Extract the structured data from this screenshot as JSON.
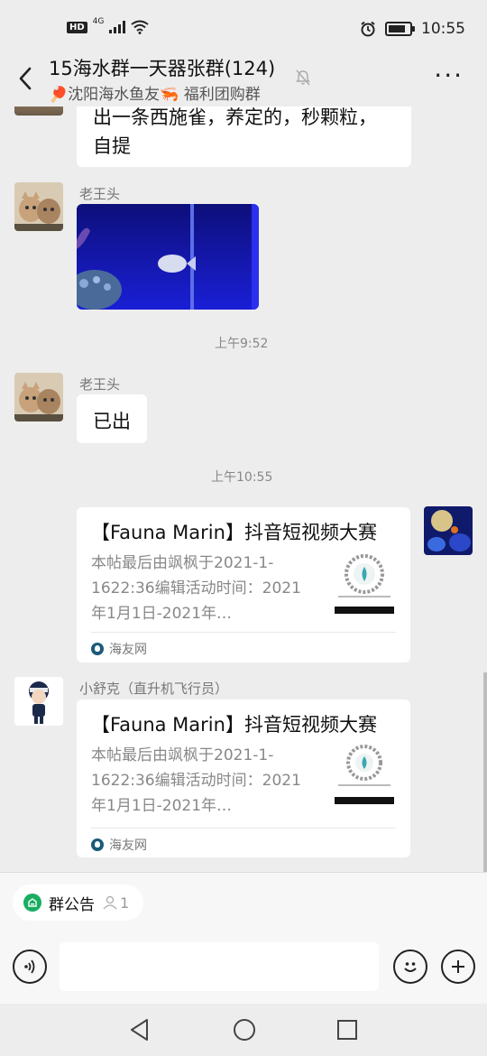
{
  "status_bar": {
    "hd": "HD",
    "network": "4G",
    "time": "10:55"
  },
  "header": {
    "title": "15海水群一天器张群(124)",
    "subtitle": "🏓沈阳海水鱼友🦐 福利团购群"
  },
  "messages": {
    "partial_text": {
      "line1": "出一条西施雀，养定的，秒颗粒，",
      "line2": "自提"
    },
    "image_message": {
      "sender": "老王头"
    },
    "timestamp1": "上午9:52",
    "text_message": {
      "sender": "老王头",
      "text": "已出"
    },
    "timestamp2": "上午10:55",
    "link_card_self": {
      "title": "【Fauna Marin】抖音短视频大赛",
      "desc": "本帖最后由飒枫于2021-1-1622:36编辑活动时间：2021年1月1日-2021年…",
      "source": "海友网"
    },
    "link_card_other": {
      "sender": "小舒克（直升机飞行员）",
      "title": "【Fauna Marin】抖音短视频大赛",
      "desc": "本帖最后由飒枫于2021-1-1622:36编辑活动时间：2021年1月1日-2021年…",
      "source": "海友网"
    }
  },
  "announcement": {
    "label": "群公告",
    "count": "1"
  },
  "icons": {
    "back": "back-arrow-icon",
    "mute": "bell-muted-icon",
    "more": "more-icon",
    "voice": "voice-icon",
    "emoji": "emoji-icon",
    "plus": "plus-icon"
  },
  "colors": {
    "background": "#ededed",
    "bubble": "#ffffff",
    "accent_green": "#1aad62",
    "fish_tank_blue": "#1a1fd6"
  }
}
